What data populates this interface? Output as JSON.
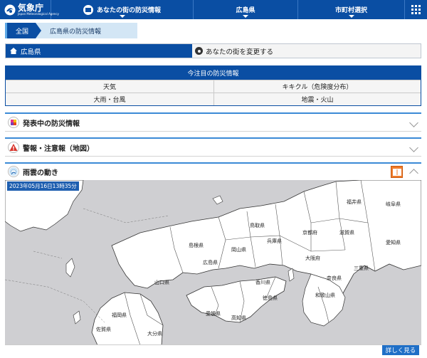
{
  "header": {
    "logo_jp": "気象庁",
    "logo_en": "Japan Meteorological Agency",
    "tabs": [
      {
        "label": "あなたの街の防災情報"
      },
      {
        "label": "広島県"
      },
      {
        "label": "市町村選択"
      }
    ]
  },
  "breadcrumb": {
    "root": "全国",
    "current": "広島県の防災情報"
  },
  "area": {
    "selected": "広島県",
    "change_label": "あなたの街を変更する"
  },
  "attention": {
    "title": "今注目の防災情報",
    "items": [
      "天気",
      "キキクル（危険度分布）",
      "大雨・台風",
      "地震・火山"
    ]
  },
  "panels": {
    "warnings_active": "発表中の防災情報",
    "warnings_map": "警報・注意報（地図）",
    "rain_cloud": "雨雲の動き"
  },
  "map": {
    "timestamp": "2023年05月16日13時35分",
    "prefectures": [
      "福井県",
      "岐阜県",
      "鳥取県",
      "京都府",
      "滋賀県",
      "島根県",
      "兵庫県",
      "愛知県",
      "岡山県",
      "大阪府",
      "三重県",
      "広島県",
      "奈良県",
      "山口県",
      "香川県",
      "徳島県",
      "和歌山県",
      "愛媛県",
      "高知県",
      "福岡県",
      "佐賀県",
      "大分県"
    ],
    "detail_button": "詳しく見る"
  },
  "colors": {
    "brand_blue": "#0a4ea3",
    "accent_orange": "#f07b2a",
    "map_land": "#ffffff",
    "map_sea": "#cfcfd2"
  }
}
